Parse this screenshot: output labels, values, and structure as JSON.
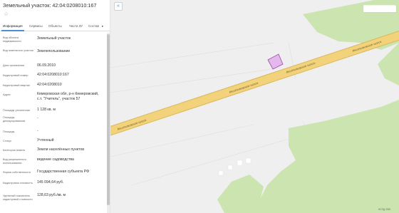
{
  "panel": {
    "title": "Земельный участок: 42:04:0208010:167",
    "star_icon": "star-outline-icon",
    "tabs": [
      "Информация",
      "Сервисы",
      "Объекты",
      "Части ЗУ",
      "Состав"
    ],
    "active_tab": "Информация",
    "tab_arrow": "▸",
    "rows": [
      {
        "label": "Вид объекта недвижимости",
        "value": "Земельный участок"
      },
      {
        "label": "Вид земельного участка",
        "value": "Землепользование"
      },
      {
        "label": "Дата присвоения",
        "value": "06.09.2010"
      },
      {
        "label": "Кадастровый номер",
        "value": "42:04:0208010:167"
      },
      {
        "label": "Кадастровый квартал",
        "value": "42:04:0208010"
      },
      {
        "label": "Адрес",
        "value": "Кемеровская обл, р-н Кемеровский, с.т. \"Учитель\", участок 57"
      },
      {
        "label": "Площадь уточненная",
        "value": "1 128 кв. м"
      },
      {
        "label": "Площадь декларированная",
        "value": "-"
      },
      {
        "label": "Площадь",
        "value": "-"
      },
      {
        "label": "Статус",
        "value": "Учтенный"
      },
      {
        "label": "Категория земель",
        "value": "Земли населённых пунктов"
      },
      {
        "label": "Вид разрешенного использования",
        "value": "ведение садоводства"
      },
      {
        "label": "Форма собственности",
        "value": "Государственная субъекта РФ"
      },
      {
        "label": "Кадастровая стоимость",
        "value": "145 094,64 руб."
      },
      {
        "label": "Удельный показатель кадастровой стоимости",
        "value": "128,63 руб./кв. м"
      }
    ]
  },
  "map": {
    "collapse_icon": "double-chevron-left-icon",
    "collapse_label": "«",
    "road_name": "Лесопилковское шоссе",
    "credit": "НСПД 2025",
    "colors": {
      "road": "#f2d27a",
      "road_edge": "#d9b75a",
      "forest": "#cbe4b0",
      "parcel_fill": "#e3b8ec",
      "parcel_stroke": "#9b4aa8",
      "background": "#efefef"
    }
  }
}
